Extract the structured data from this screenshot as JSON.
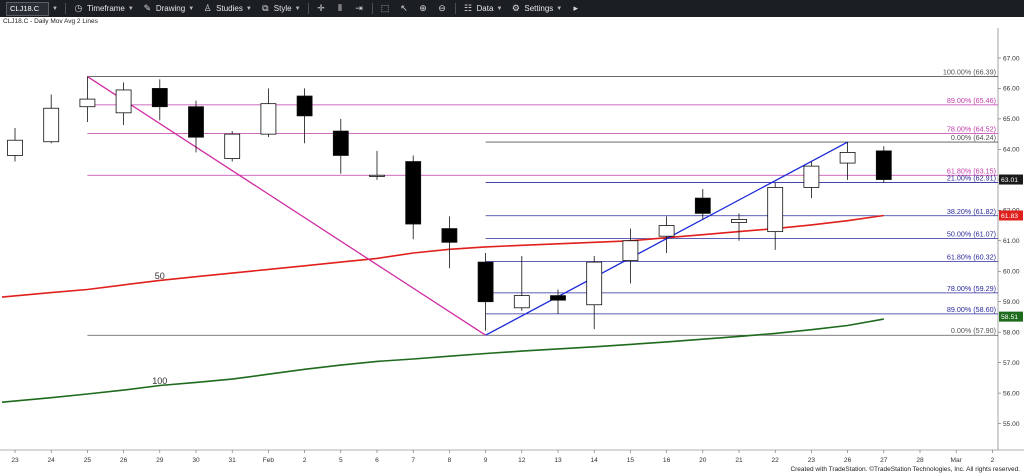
{
  "toolbar": {
    "symbol": "CLJ18.C",
    "timeframe": "Timeframe",
    "drawing": "Drawing",
    "studies": "Studies",
    "style": "Style",
    "data": "Data",
    "settings": "Settings"
  },
  "plot_title": "CLJ18.C - Daily  Mov Avg 2 Lines",
  "footer": {
    "created": "Created with TradeStation.",
    "copyright": "©TradeStation Technologies, Inc. All rights reserved."
  },
  "colors": {
    "up_candle": "#ffffff",
    "down_candle": "#000000",
    "ma50": "#e0201c",
    "ma100": "#1e6b1e",
    "fib_gray": "#555555",
    "fib_magenta": "#c03aa8",
    "fib_blue": "#2a2a9a",
    "trend_down": "#d02ca0",
    "trend_up": "#1a2ad8"
  },
  "chart_data": {
    "type": "candlestick",
    "x_tick_labels": [
      "23",
      "24",
      "25",
      "26",
      "29",
      "30",
      "31",
      "Feb",
      "2",
      "5",
      "6",
      "7",
      "8",
      "9",
      "12",
      "13",
      "14",
      "15",
      "16",
      "20",
      "21",
      "22",
      "23",
      "26",
      "27",
      "28",
      "Mar",
      "2"
    ],
    "y_tick_labels": [
      "67.00",
      "66.00",
      "65.00",
      "64.00",
      "63.00",
      "62.00",
      "61.00",
      "60.00",
      "59.00",
      "58.00",
      "57.00",
      "56.00",
      "55.00"
    ],
    "ylim": [
      54.6,
      67.5
    ],
    "candles": [
      {
        "date": "23",
        "open": 63.8,
        "high": 64.7,
        "low": 63.6,
        "close": 64.3
      },
      {
        "date": "24",
        "open": 64.25,
        "high": 65.8,
        "low": 64.2,
        "close": 65.35
      },
      {
        "date": "25",
        "open": 65.4,
        "high": 66.39,
        "low": 64.9,
        "close": 65.65
      },
      {
        "date": "26",
        "open": 65.2,
        "high": 66.2,
        "low": 64.8,
        "close": 65.95
      },
      {
        "date": "29",
        "open": 66.0,
        "high": 66.3,
        "low": 64.95,
        "close": 65.4
      },
      {
        "date": "30",
        "open": 65.4,
        "high": 65.6,
        "low": 63.9,
        "close": 64.4
      },
      {
        "date": "31",
        "open": 63.7,
        "high": 64.6,
        "low": 63.6,
        "close": 64.5
      },
      {
        "date": "Feb",
        "open": 64.5,
        "high": 66.0,
        "low": 64.4,
        "close": 65.5
      },
      {
        "date": "2",
        "open": 65.75,
        "high": 66.0,
        "low": 64.2,
        "close": 65.1
      },
      {
        "date": "5",
        "open": 64.6,
        "high": 65.0,
        "low": 63.2,
        "close": 63.8
      },
      {
        "date": "6",
        "open": 63.15,
        "high": 63.95,
        "low": 63.0,
        "close": 63.15
      },
      {
        "date": "7",
        "open": 63.6,
        "high": 63.8,
        "low": 61.05,
        "close": 61.55
      },
      {
        "date": "8",
        "open": 61.4,
        "high": 61.8,
        "low": 60.1,
        "close": 60.95
      },
      {
        "date": "9",
        "open": 60.3,
        "high": 60.6,
        "low": 58.05,
        "close": 59.0
      },
      {
        "date": "12",
        "open": 58.8,
        "high": 60.5,
        "low": 58.7,
        "close": 59.2
      },
      {
        "date": "13",
        "open": 59.2,
        "high": 59.4,
        "low": 58.6,
        "close": 59.05
      },
      {
        "date": "14",
        "open": 58.9,
        "high": 60.5,
        "low": 58.1,
        "close": 60.3
      },
      {
        "date": "15",
        "open": 60.35,
        "high": 61.4,
        "low": 59.6,
        "close": 61.0
      },
      {
        "date": "16",
        "open": 61.15,
        "high": 61.8,
        "low": 60.6,
        "close": 61.5
      },
      {
        "date": "20",
        "open": 62.4,
        "high": 62.7,
        "low": 61.7,
        "close": 61.9
      },
      {
        "date": "21",
        "open": 61.6,
        "high": 61.9,
        "low": 61.0,
        "close": 61.7
      },
      {
        "date": "22",
        "open": 61.3,
        "high": 62.9,
        "low": 60.7,
        "close": 62.75
      },
      {
        "date": "23",
        "open": 62.75,
        "high": 63.6,
        "low": 62.4,
        "close": 63.45
      },
      {
        "date": "26",
        "open": 63.55,
        "high": 64.24,
        "low": 63.0,
        "close": 63.9
      },
      {
        "date": "27",
        "open": 63.95,
        "high": 64.1,
        "low": 62.9,
        "close": 63.01
      }
    ],
    "series": [
      {
        "name": "50",
        "values": [
          59.15,
          59.3,
          59.4,
          59.55,
          59.7,
          59.82,
          59.94,
          60.06,
          60.18,
          60.3,
          60.42,
          60.6,
          60.72,
          60.8,
          60.85,
          60.9,
          60.95,
          61.0,
          61.1,
          61.2,
          61.3,
          61.4,
          61.52,
          61.66,
          61.83
        ]
      },
      {
        "name": "100",
        "values": [
          55.7,
          55.85,
          55.97,
          56.1,
          56.25,
          56.35,
          56.46,
          56.62,
          56.78,
          56.92,
          57.04,
          57.12,
          57.21,
          57.3,
          57.38,
          57.45,
          57.52,
          57.6,
          57.68,
          57.77,
          57.86,
          57.96,
          58.08,
          58.22,
          58.43
        ]
      }
    ],
    "fib_levels_long": [
      {
        "label": "100.00% (66.39)",
        "value": 66.39,
        "color": "gray"
      },
      {
        "label": "89.00% (65.46)",
        "value": 65.46,
        "color": "magenta"
      },
      {
        "label": "78.00% (64.52)",
        "value": 64.52,
        "color": "magenta"
      },
      {
        "label": "61.80% (63.15)",
        "value": 63.15,
        "color": "magenta"
      },
      {
        "label": "0.00% (57.90)",
        "value": 57.9,
        "color": "gray"
      }
    ],
    "fib_levels_short": [
      {
        "label": "0.00% (64.24)",
        "value": 64.24,
        "color": "gray"
      },
      {
        "label": "21.00% (62.91)",
        "value": 62.91,
        "color": "blue"
      },
      {
        "label": "38.20% (61.82)",
        "value": 61.82,
        "color": "blue"
      },
      {
        "label": "50.00% (61.07)",
        "value": 61.07,
        "color": "blue"
      },
      {
        "label": "61.80% (60.32)",
        "value": 60.32,
        "color": "blue"
      },
      {
        "label": "78.00% (59.29)",
        "value": 59.29,
        "color": "blue"
      },
      {
        "label": "89.00% (58.60)",
        "value": 58.6,
        "color": "blue"
      }
    ],
    "trendlines": [
      {
        "name": "down",
        "from": {
          "date": "25",
          "value": 66.39
        },
        "to": {
          "date": "9",
          "value": 57.9
        }
      },
      {
        "name": "up",
        "from": {
          "date": "9",
          "value": 57.9
        },
        "to": {
          "date": "26",
          "value": 64.24
        }
      }
    ],
    "ma_labels": [
      {
        "text": "50",
        "date": "29",
        "value": 59.85
      },
      {
        "text": "100",
        "date": "29",
        "value": 56.4
      }
    ],
    "price_badges": [
      {
        "text": "63.01",
        "value": 63.01,
        "color": "#1a1a1a"
      },
      {
        "text": "61.83",
        "value": 61.83,
        "color": "#e0201c"
      },
      {
        "text": "58.51",
        "value": 58.51,
        "color": "#1e6b1e"
      }
    ]
  }
}
